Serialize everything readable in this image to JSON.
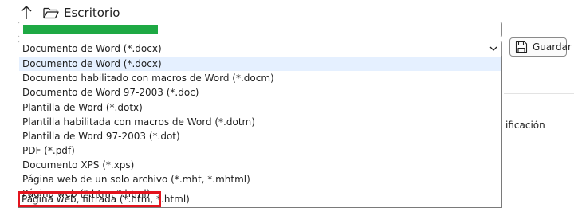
{
  "nav": {
    "up_icon": "arrow-up-icon",
    "folder_icon": "folder-icon",
    "current_folder": "Escritorio"
  },
  "filename": {
    "value": "",
    "selection_color": "#1ea944"
  },
  "file_type": {
    "selected": "Documento de Word (*.docx)",
    "options": [
      "Documento de Word (*.docx)",
      "Documento habilitado con macros de Word (*.docm)",
      "Documento de Word 97-2003 (*.doc)",
      "Plantilla de Word (*.dotx)",
      "Plantilla habilitada con macros de Word (*.dotm)",
      "Plantilla de Word 97-2003 (*.dot)",
      "PDF (*.pdf)",
      "Documento XPS (*.xps)",
      "Página web de un solo archivo (*.mht, *.mhtml)",
      "Página web (*.htm, *.html)",
      "Página web, filtrada (*.htm, *.html)"
    ],
    "highlighted_option": "Página web, filtrada (*.htm, *.html)",
    "highlight_color": "#e3141e"
  },
  "save_button": {
    "label": "Guardar",
    "icon": "save-icon"
  },
  "background": {
    "partial_text": "ificación"
  }
}
